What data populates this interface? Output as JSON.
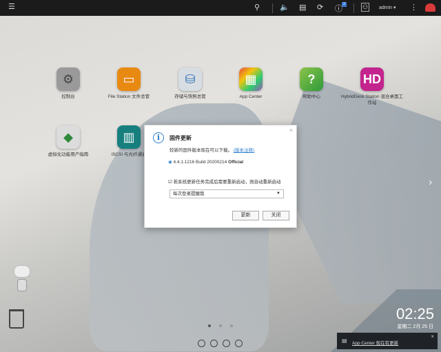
{
  "topbar": {
    "menu_icon": "hamburger-icon",
    "user": "admin",
    "notification_count": "2"
  },
  "apps": [
    {
      "label": "控制台",
      "icon": "gear-icon",
      "color": "#8a8a8a"
    },
    {
      "label": "File Station 文件总管",
      "icon": "folder-icon",
      "color": "#e88a12"
    },
    {
      "label": "存储与快照总管",
      "icon": "storage-icon",
      "color": "#3b7fc4"
    },
    {
      "label": "App Center",
      "icon": "grid-icon",
      "color": "#c94a9a"
    },
    {
      "label": "帮助中心",
      "icon": "question-icon",
      "color": "#4aa83a"
    },
    {
      "label": "HybridDesk Station 混合桌面工作站",
      "icon": "hd-icon",
      "color": "#c3248d"
    },
    {
      "label": "虚拟化功能用户指南",
      "icon": "cube-icon",
      "color": "#3b8f4a"
    },
    {
      "label": "iSCSI 与光纤通道",
      "icon": "iscsi-icon",
      "color": "#1a8b8b"
    }
  ],
  "dialog": {
    "title": "固件更新",
    "message": "较新的固件版本现在可以下载。",
    "release_notes_link": "(版本注释)",
    "version": "4.4.1.1216 Build 20200214",
    "edition": "Official",
    "auto_restart_label": "若系统更新任务完成后需要重新启动，则自动重新启动",
    "auto_restart_checked": true,
    "reminder_select": "每次登录提醒我",
    "update_button": "更新",
    "close_button": "关闭"
  },
  "clock": {
    "time": "02:25",
    "date": "星期二 2月 25 日"
  },
  "notification": {
    "text": "App Center 现在有更新"
  }
}
